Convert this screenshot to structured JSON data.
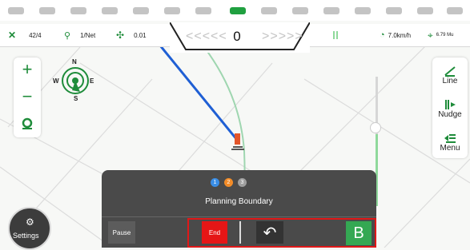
{
  "top_bar": {
    "indicators": [
      "page-1",
      "page-2",
      "page-3",
      "page-4",
      "page-5",
      "page-6",
      "page-7",
      "page-8",
      "page-9",
      "page-10",
      "page-11",
      "page-12",
      "page-13",
      "page-14",
      "page-15"
    ],
    "active_index": 7
  },
  "status": {
    "satellites": "42/4",
    "signal": "1/Net",
    "offset": "0.01",
    "speed": "7.0km/h",
    "rate": "6.79 Mu"
  },
  "nav": {
    "left_arrows": "<<<<<",
    "value": "0",
    "right_arrows": ">>>>>"
  },
  "compass": {
    "n": "N",
    "s": "S",
    "e": "E",
    "w": "W"
  },
  "zoom": {
    "in": "+",
    "out": "−"
  },
  "right_menu": [
    {
      "label": "Line",
      "icon": "line-icon"
    },
    {
      "label": "Nudge",
      "icon": "nudge-icon"
    },
    {
      "label": "Menu",
      "icon": "menu-icon"
    }
  ],
  "planning": {
    "steps": [
      "1",
      "2",
      "3"
    ],
    "step_colors": [
      "#3a8ee6",
      "#f28c28",
      "#9e9e9e"
    ],
    "title": "Planning Boundary",
    "pause": "Pause",
    "end": "End",
    "b": "B"
  },
  "settings": {
    "label": "Settings"
  },
  "colors": {
    "accent": "#1e8c3a",
    "end": "#e51616",
    "b": "#34a853",
    "track": "#1f5fd4"
  }
}
